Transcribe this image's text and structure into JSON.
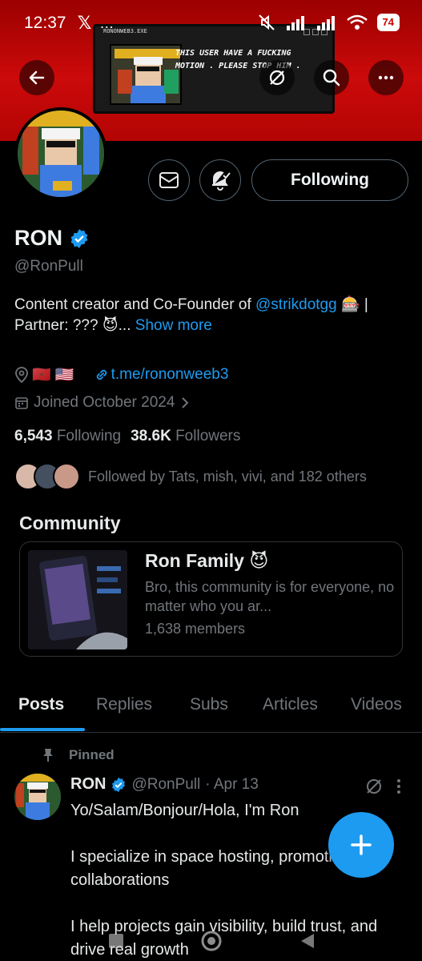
{
  "status_bar": {
    "time": "12:37",
    "app_icon": "x-logo",
    "more": "…",
    "battery": "74"
  },
  "banner": {
    "window_title": "RONONWEB3.EXE",
    "caption": "THIS USER HAVE A FUCKING MOTION . PLEASE STOP HIM ."
  },
  "profile": {
    "name": "RON",
    "handle": "@RonPull",
    "follow_button": "Following",
    "bio_prefix": "Content creator and Co-Founder of ",
    "bio_mention": "@strikdotgg",
    "bio_emoji": "🎰",
    "bio_suffix": " | Partner: ??? 😈...",
    "show_more": "Show more",
    "flags": "🇲🇦 🇺🇸",
    "website": "t.me/rononweeb3",
    "joined": "Joined October 2024",
    "following_count": "6,543",
    "following_label": "Following",
    "followers_count": "38.6K",
    "followers_label": "Followers",
    "followed_by": "Followed by Tats, mish, vivi, and 182 others"
  },
  "community": {
    "heading": "Community",
    "title": "Ron Family 😈",
    "description": "Bro, this community is for everyone, no matter who you ar...",
    "members": "1,638 members"
  },
  "tabs": [
    "Posts",
    "Replies",
    "Subs",
    "Articles",
    "Videos"
  ],
  "pinned_post": {
    "pinned_label": "Pinned",
    "author": "RON",
    "handle": "@RonPull",
    "date": "· Apr 13",
    "line1": "Yo/Salam/Bonjour/Hola, I'm Ron",
    "line2": "I specialize in space hosting, promotions & collaborations",
    "line3": "I help projects gain visibility, build trust, and drive real growth"
  },
  "colors": {
    "accent": "#1d9bf0",
    "banner_red": "#c40808",
    "muted": "#71767b"
  }
}
